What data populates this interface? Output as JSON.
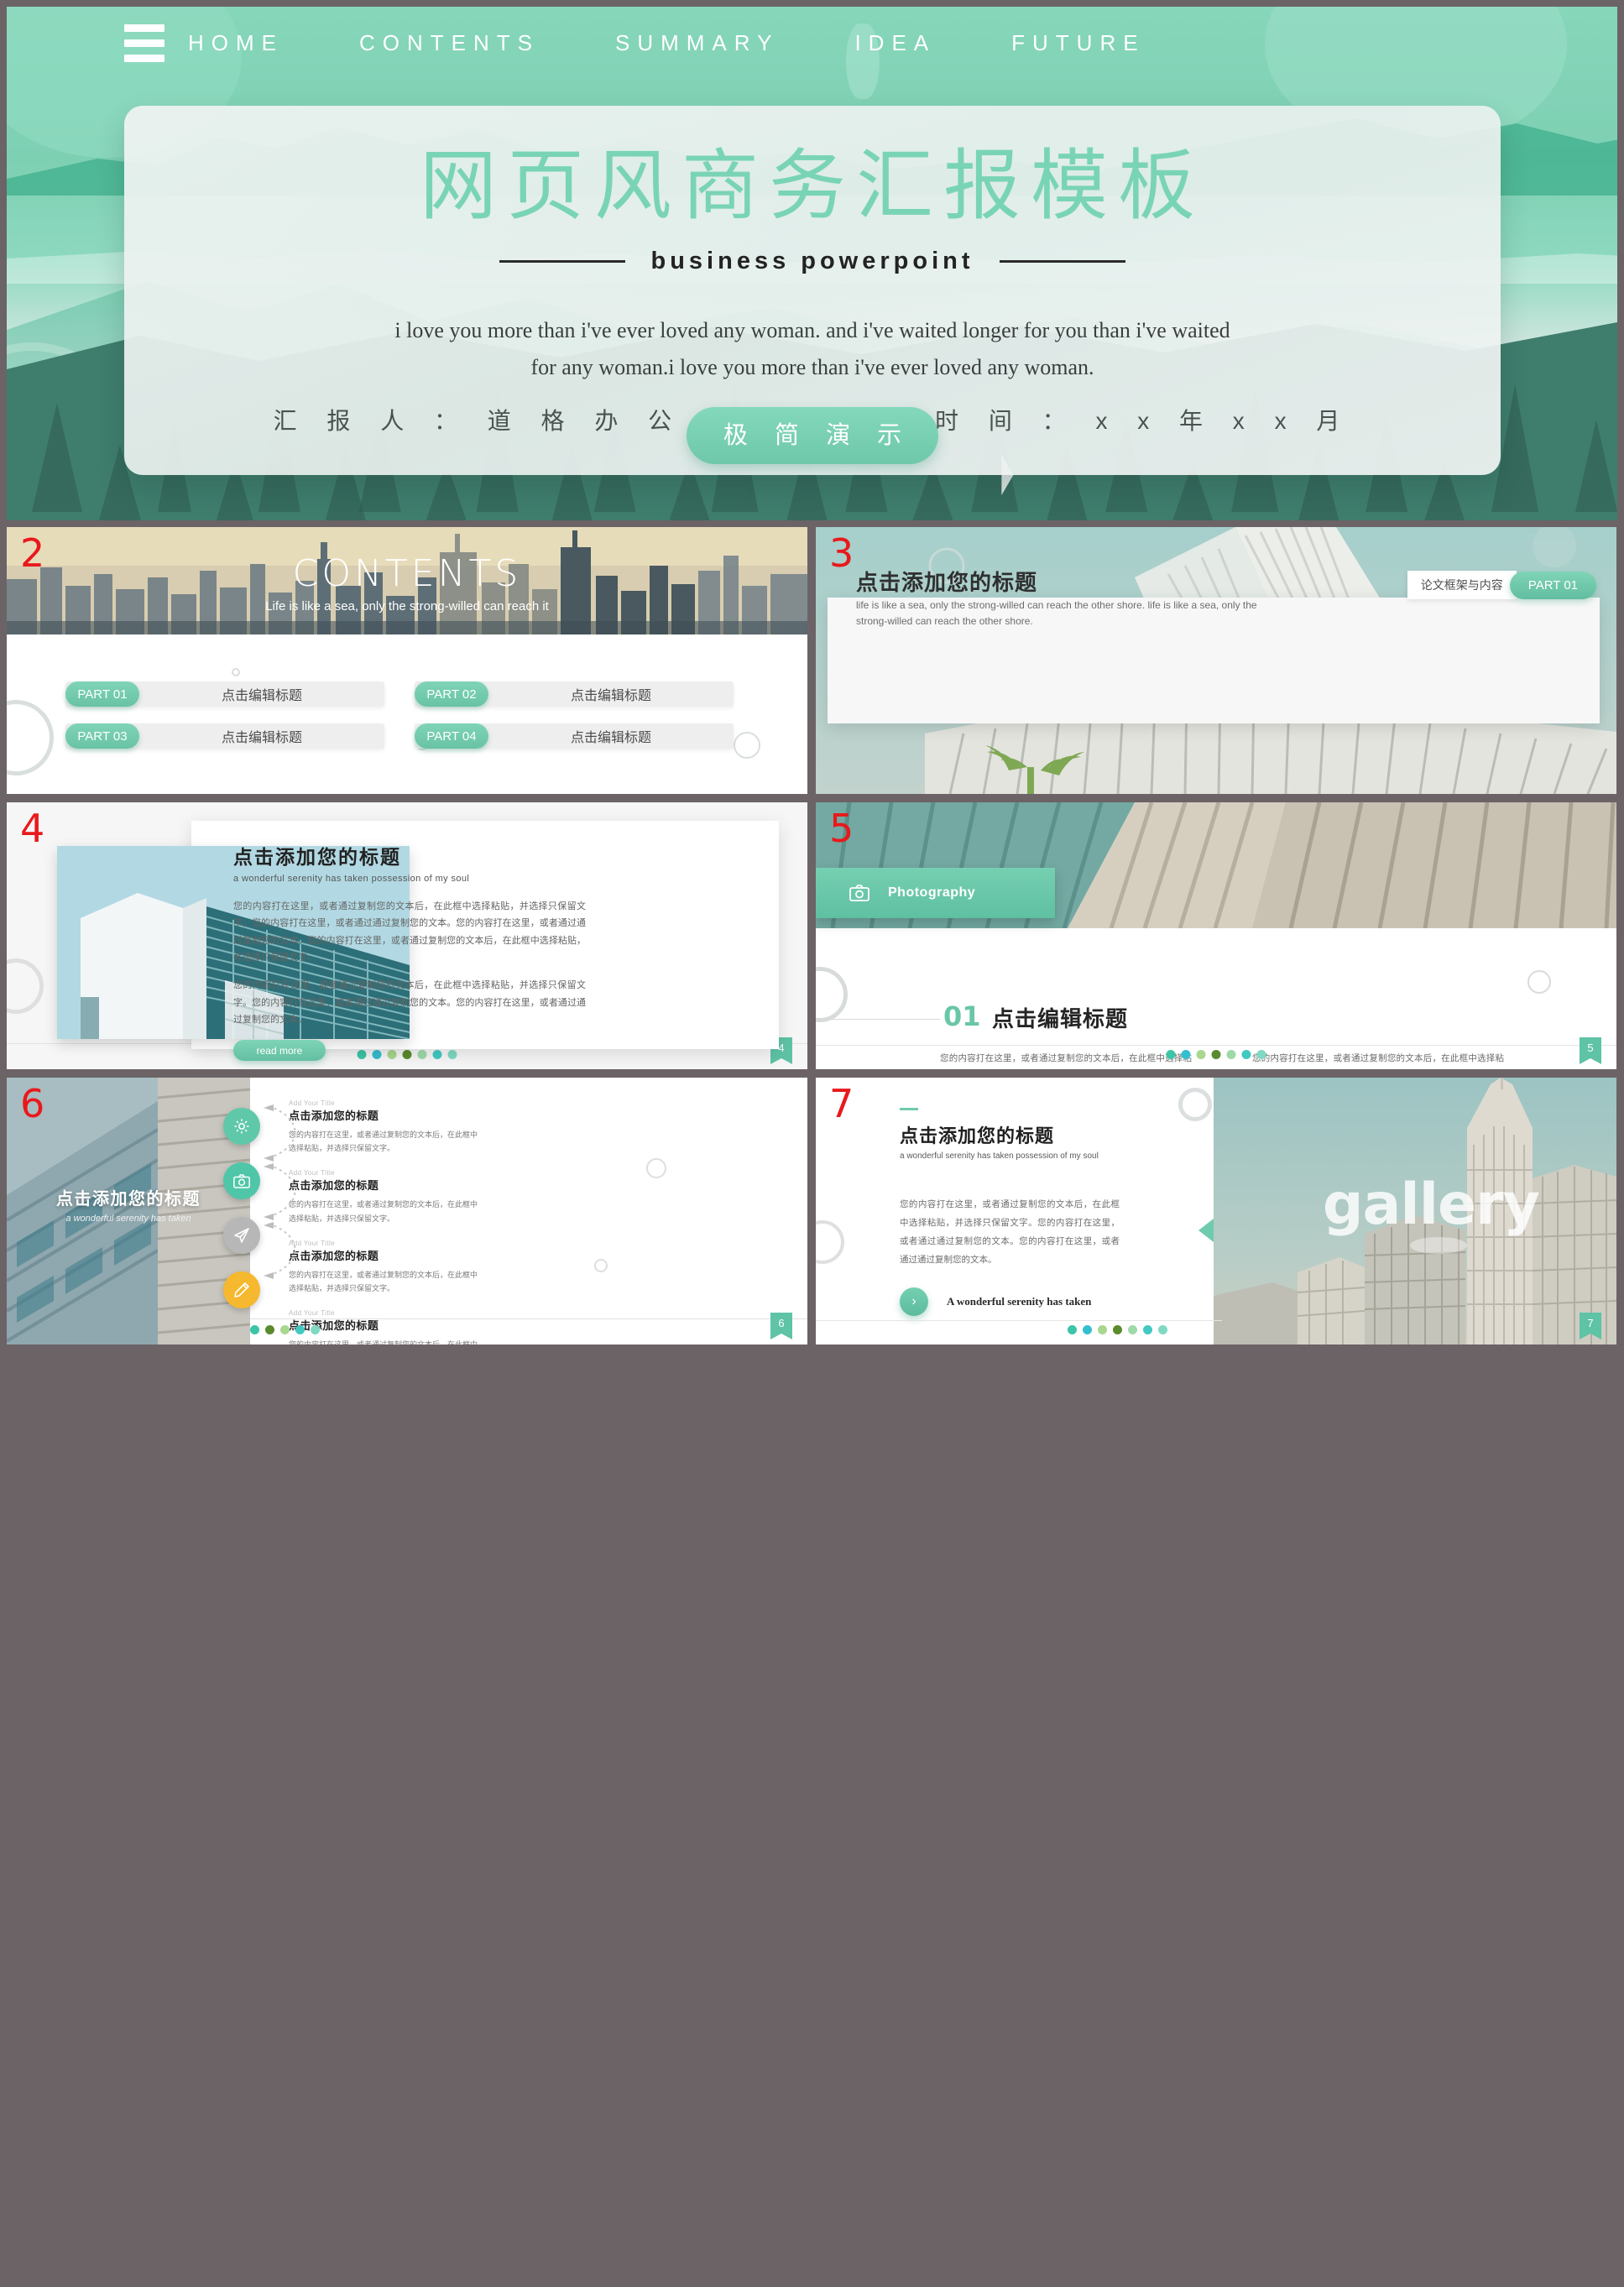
{
  "hero": {
    "nav": [
      {
        "label": "HOME"
      },
      {
        "label": "CONTENTS"
      },
      {
        "label": "SUMMARY"
      },
      {
        "label": "IDEA"
      },
      {
        "label": "FUTURE"
      }
    ],
    "title": "网页风商务汇报模板",
    "subtitle": "business powerpoint",
    "quote": "i love you more than i've ever loved any woman. and i've waited longer for you than i've waited for any woman.i love you more than i've ever loved any woman.",
    "cta": "极 简 演 示",
    "presenter": "汇 报 人 ： 道 格 办 公",
    "date": "时 间 ： x x 年 x x 月"
  },
  "slides": {
    "s2": {
      "number": "2",
      "title": "CONTENTS",
      "subtitle": "Life is like a sea, only the strong-willed can reach it",
      "parts": [
        {
          "tag": "PART 01",
          "text": "点击编辑标题"
        },
        {
          "tag": "PART 02",
          "text": "点击编辑标题"
        },
        {
          "tag": "PART 03",
          "text": "点击编辑标题"
        },
        {
          "tag": "PART 04",
          "text": "点击编辑标题"
        }
      ]
    },
    "s3": {
      "number": "3",
      "title": "点击添加您的标题",
      "body": "life is like a sea, only the strong-willed can reach the other shore. life is like a sea, only the strong-willed can reach the other shore.",
      "label": "论文框架与内容",
      "pill": "PART 01"
    },
    "s4": {
      "number": "4",
      "title": "点击添加您的标题",
      "subtitle": "a wonderful serenity has taken possession of my soul",
      "para1": "您的内容打在这里，或者通过复制您的文本后，在此框中选择粘贴，并选择只保留文字。您的内容打在这里，或者通过通过复制您的文本。您的内容打在这里，或者通过通过复制您的文本。您的内容打在这里，或者通过复制您的文本后，在此框中选择粘贴，并选择只保留文字。",
      "para2": "您的内容打在这里，或者通过复制您的文本后，在此框中选择粘贴，并选择只保留文字。您的内容打在这里，或者通过通过复制您的文本。您的内容打在这里，或者通过通过复制您的文本。",
      "button": "read more",
      "page": "4"
    },
    "s5": {
      "number": "5",
      "tab": "Photography",
      "num": "01",
      "title": "点击编辑标题",
      "col1": "您的内容打在这里，或者通过复制您的文本后，在此框中选择粘贴，并选择只保留文字。您的内容打在这里，或者通过通过复制您的文本。您的内容打在这里，或者通过通过复制您的文本。您的内容打在这里，或者通过复制您的文本后，在此框中选择粘贴，并选择只保留文字。",
      "col2": "您的内容打在这里，或者通过复制您的文本后，在此框中选择粘贴，并选择只保留文字。您的内容打在这里，或者通过通过复制您的文本。您的内容打在这里，或者通过通过复制您的文本。您的内容打在这里，或者通过复制您的文本后，在此框中选择粘贴，并选择只保留文字。",
      "page": "5"
    },
    "s6": {
      "number": "6",
      "overlay_title": "点击添加您的标题",
      "overlay_sub": "a wonderful serenity has taken",
      "page": "6",
      "items": [
        {
          "eyebrow": "Add Your Title",
          "title": "点击添加您的标题",
          "body": "您的内容打在这里，或者通过复制您的文本后，在此框中选择粘贴，并选择只保留文字。",
          "icon": "gear-icon",
          "color": "#5fc8a8"
        },
        {
          "eyebrow": "Add Your Title",
          "title": "点击添加您的标题",
          "body": "您的内容打在这里，或者通过复制您的文本后，在此框中选择粘贴，并选择只保留文字。",
          "icon": "camera-icon",
          "color": "#4fc6a8"
        },
        {
          "eyebrow": "Add Your Title",
          "title": "点击添加您的标题",
          "body": "您的内容打在这里，或者通过复制您的文本后，在此框中选择粘贴，并选择只保留文字。",
          "icon": "send-icon",
          "color": "#b7b7b7"
        },
        {
          "eyebrow": "Add Your Title",
          "title": "点击添加您的标题",
          "body": "您的内容打在这里，或者通过复制您的文本后，在此框中选择粘贴，并选择只保留文字。",
          "icon": "edit-icon",
          "color": "#f5b82e"
        }
      ]
    },
    "s7": {
      "number": "7",
      "title": "点击添加您的标题",
      "subtitle": "a wonderful serenity has taken possession of my soul",
      "body": "您的内容打在这里，或者通过复制您的文本后，在此框中选择粘贴，并选择只保留文字。您的内容打在这里，或者通过通过复制您的文本。您的内容打在这里，或者通过通过复制您的文本。",
      "cta": "A wonderful serenity has taken",
      "gallery": "gallery",
      "page": "7"
    }
  },
  "theme": {
    "accent": "#6fcbad",
    "accent_dark": "#4fb795",
    "number_color": "#e8191c",
    "dots": [
      "#3cc5a6",
      "#33bfd0",
      "#a9d78f",
      "#5a8b2d",
      "#9fd9a9",
      "#41c9c2",
      "#7fd9c3"
    ]
  }
}
